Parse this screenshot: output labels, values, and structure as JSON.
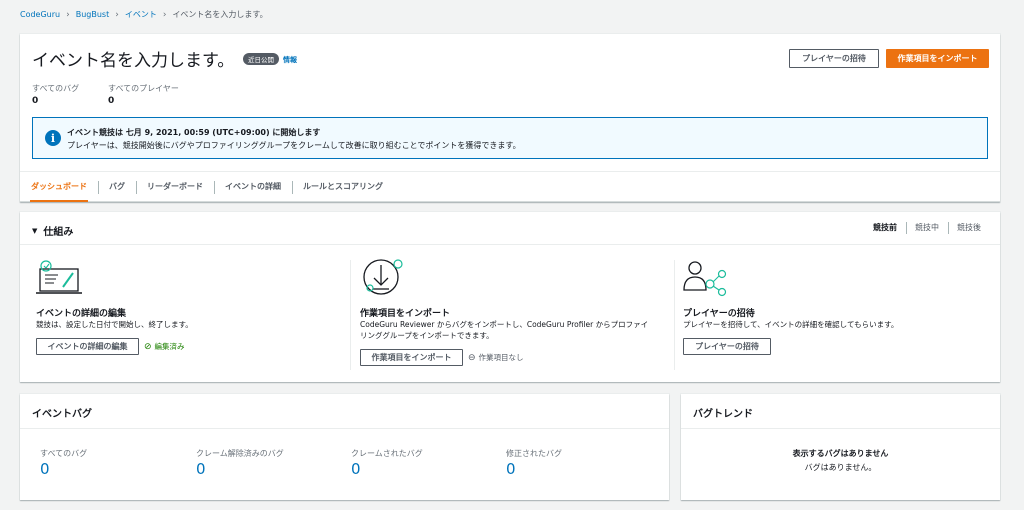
{
  "breadcrumb": {
    "items": [
      "CodeGuru",
      "BugBust",
      "イベント"
    ],
    "current": "イベント名を入力します。"
  },
  "header": {
    "title": "イベント名を入力します。",
    "badge": "近日公開",
    "info_link": "情報",
    "invite_button": "プレイヤーの招待",
    "import_button": "作業項目をインポート",
    "stats": [
      {
        "label": "すべてのバグ",
        "value": "0"
      },
      {
        "label": "すべてのプレイヤー",
        "value": "0"
      }
    ]
  },
  "alert": {
    "title": "イベント競技は 七月 9, 2021, 00:59 (UTC+09:00) に開始します",
    "desc": "プレイヤーは、競技開始後にバグやプロファイリンググループをクレームして改善に取り組むことでポイントを獲得できます。"
  },
  "tabs": [
    "ダッシュボード",
    "バグ",
    "リーダーボード",
    "イベントの詳細",
    "ルールとスコアリング"
  ],
  "how": {
    "title": "仕組み",
    "phases": [
      "競技前",
      "競技中",
      "競技後"
    ],
    "steps": [
      {
        "title": "イベントの詳細の編集",
        "desc": "競技は、設定した日付で開始し、終了します。",
        "button": "イベントの詳細の編集",
        "status": "編集済み"
      },
      {
        "title": "作業項目をインポート",
        "desc1": "CodeGuru Reviewer からバグをインポートし、CodeGuru Profiler からプロファイ",
        "desc2": "リンググループをインポートできます。",
        "button": "作業項目をインポート",
        "status": "作業項目なし"
      },
      {
        "title": "プレイヤーの招待",
        "desc": "プレイヤーを招待して、イベントの詳細を確認してもらいます。",
        "button": "プレイヤーの招待"
      }
    ]
  },
  "event_bugs": {
    "title": "イベントバグ",
    "stats": [
      {
        "label": "すべてのバグ",
        "value": "0"
      },
      {
        "label": "クレーム解除済みのバグ",
        "value": "0"
      },
      {
        "label": "クレームされたバグ",
        "value": "0"
      },
      {
        "label": "修正されたバグ",
        "value": "0"
      }
    ]
  },
  "bug_trend": {
    "title": "バグトレンド",
    "empty_title": "表示するバグはありません",
    "empty_desc": "バグはありません。"
  },
  "colors": {
    "accent": "#ec7211",
    "link": "#0073bb",
    "success": "#1d8102"
  }
}
